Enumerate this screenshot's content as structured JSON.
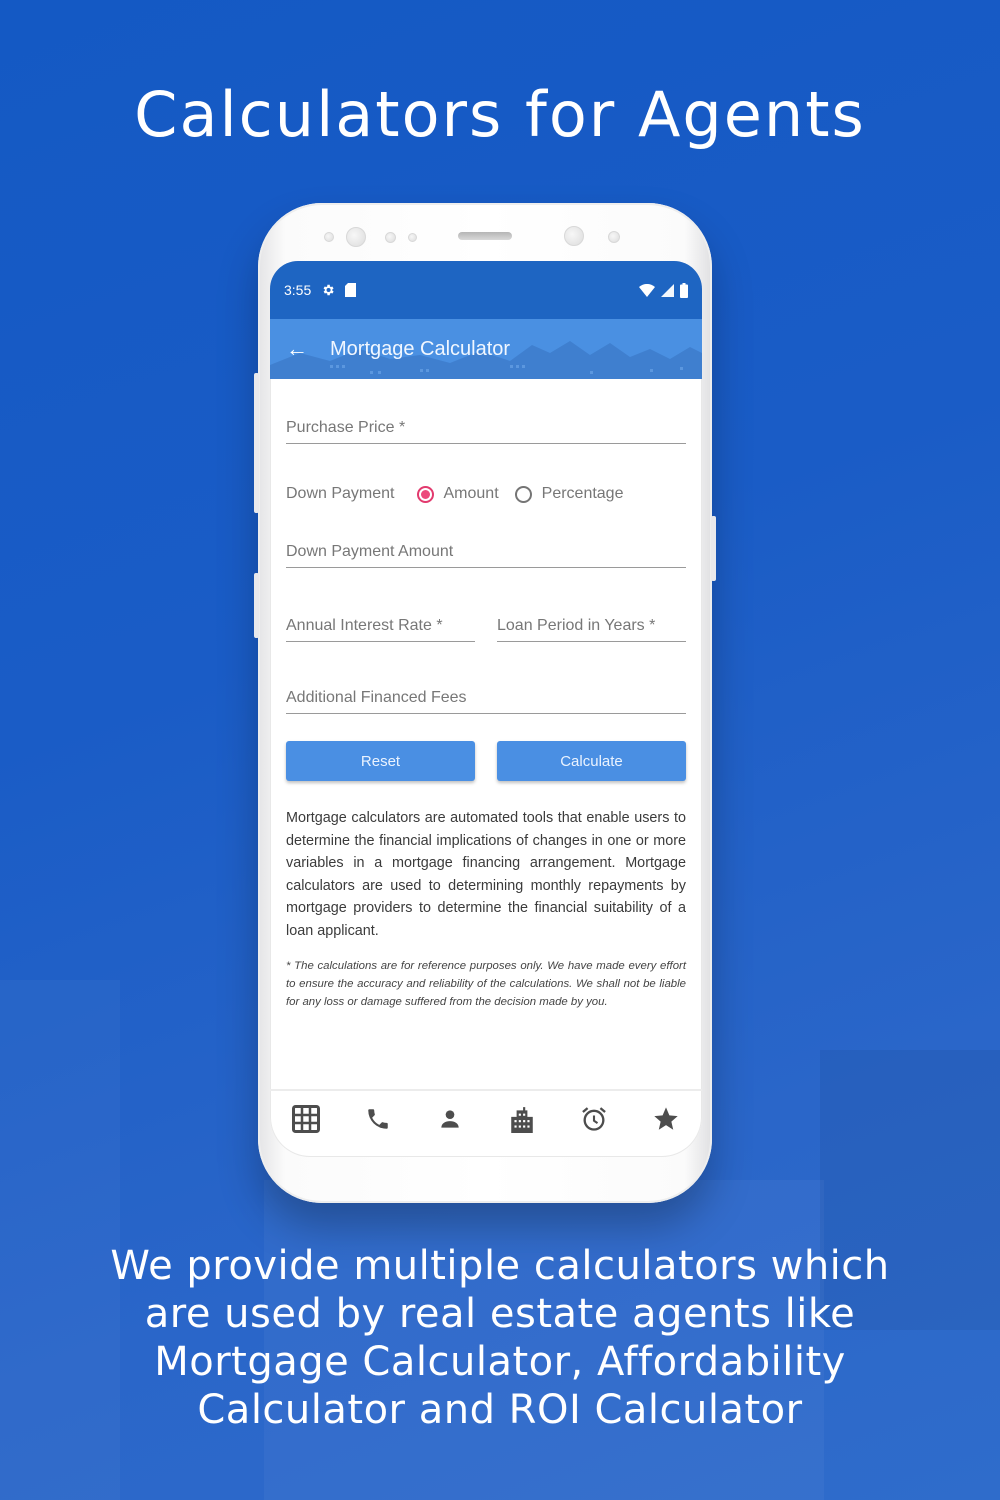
{
  "promo": {
    "headline": "Calculators for Agents",
    "caption": "We provide multiple calculators which are used by real estate agents like Mortgage Calculator, Affordability Calculator and ROI Calculator"
  },
  "status_bar": {
    "time": "3:55",
    "left_icons": [
      "gear-icon",
      "sd-card-icon"
    ],
    "right_icons": [
      "wifi-icon",
      "signal-icon",
      "battery-icon"
    ]
  },
  "app_bar": {
    "back_icon": "arrow-left-icon",
    "title": "Mortgage Calculator"
  },
  "form": {
    "purchase_price": {
      "placeholder": "Purchase Price *",
      "value": ""
    },
    "down_payment": {
      "label": "Down Payment",
      "options": [
        {
          "label": "Amount",
          "selected": true
        },
        {
          "label": "Percentage",
          "selected": false
        }
      ]
    },
    "down_payment_amount": {
      "placeholder": "Down Payment Amount",
      "value": ""
    },
    "annual_interest_rate": {
      "placeholder": "Annual Interest Rate *",
      "value": ""
    },
    "loan_period_years": {
      "placeholder": "Loan Period in Years *",
      "value": ""
    },
    "additional_financed_fees": {
      "placeholder": "Additional Financed Fees",
      "value": ""
    },
    "reset_label": "Reset",
    "calculate_label": "Calculate"
  },
  "description": "Mortgage calculators are automated tools that enable users to determine the financial implications of changes in one or more variables in a mortgage financing arrangement. Mortgage calculators are used to determining monthly repayments by mortgage providers to determine the financial suitability of a loan applicant.",
  "disclaimer": "* The calculations are for reference purposes only. We have made every effort to ensure the accuracy and reliability of the calculations. We shall not be liable for any loss or damage suffered from the decision made by you.",
  "bottom_nav": [
    {
      "icon": "grid-icon"
    },
    {
      "icon": "phone-icon"
    },
    {
      "icon": "person-icon"
    },
    {
      "icon": "building-icon"
    },
    {
      "icon": "alarm-clock-icon"
    },
    {
      "icon": "star-icon"
    }
  ],
  "colors": {
    "background": "#1a5cc6",
    "status_bar": "#1e65c2",
    "app_bar": "#4a90e2",
    "button": "#4a8fe3",
    "radio_selected": "#e23a6e",
    "nav_icon": "#4d4d4d"
  }
}
